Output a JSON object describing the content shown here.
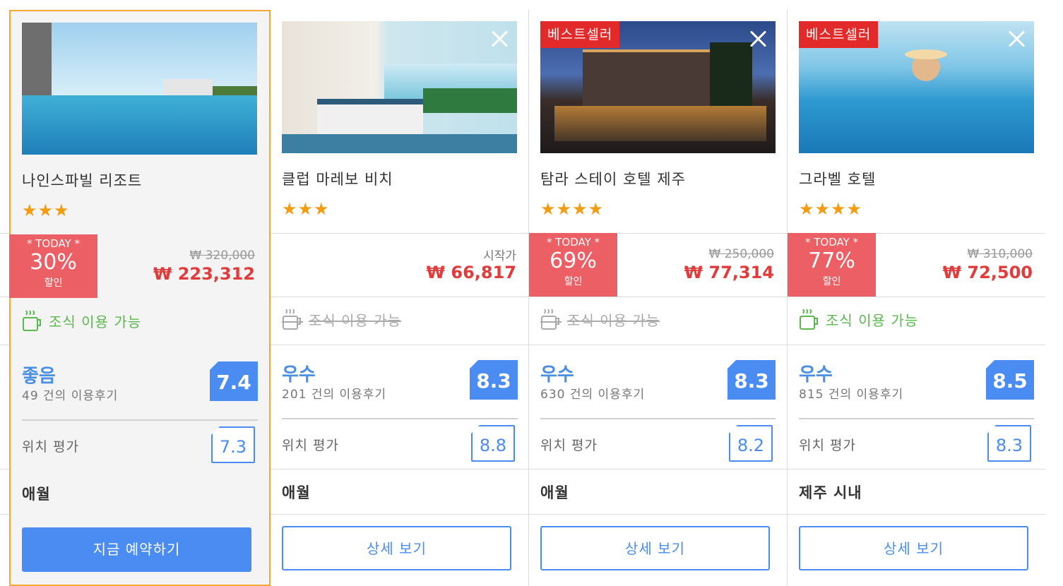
{
  "hotels": [
    {
      "name": "나인스파빌 리조트",
      "stars": "★★★",
      "best_seller": "",
      "deal": {
        "label": "* TODAY *",
        "percent": "30%",
        "unit": "할인"
      },
      "original_price": "₩ 320,000",
      "start_label": "",
      "price": "₩ 223,312",
      "breakfast": "조식 이용 가능",
      "breakfast_available": true,
      "rating_word": "좋음",
      "review_count": "49 건의 이용후기",
      "score": "7.4",
      "location_label": "위치 평가",
      "location_score": "7.3",
      "area": "애월",
      "button": "지금 예약하기"
    },
    {
      "name": "클럽 마레보 비치",
      "stars": "★★★",
      "best_seller": "",
      "deal": null,
      "original_price": "",
      "start_label": "시작가",
      "price": "₩ 66,817",
      "breakfast": "조식 이용 가능",
      "breakfast_available": false,
      "rating_word": "우수",
      "review_count": "201 건의 이용후기",
      "score": "8.3",
      "location_label": "위치 평가",
      "location_score": "8.8",
      "area": "애월",
      "button": "상세 보기"
    },
    {
      "name": "탐라 스테이 호텔 제주",
      "stars": "★★★★",
      "best_seller": "베스트셀러",
      "deal": {
        "label": "* TODAY *",
        "percent": "69%",
        "unit": "할인"
      },
      "original_price": "₩ 250,000",
      "start_label": "",
      "price": "₩ 77,314",
      "breakfast": "조식 이용 가능",
      "breakfast_available": false,
      "rating_word": "우수",
      "review_count": "630 건의 이용후기",
      "score": "8.3",
      "location_label": "위치 평가",
      "location_score": "8.2",
      "area": "애월",
      "button": "상세 보기"
    },
    {
      "name": "그라벨 호텔",
      "stars": "★★★★",
      "best_seller": "베스트셀러",
      "deal": {
        "label": "* TODAY *",
        "percent": "77%",
        "unit": "할인"
      },
      "original_price": "₩ 310,000",
      "start_label": "",
      "price": "₩ 72,500",
      "breakfast": "조식 이용 가능",
      "breakfast_available": true,
      "rating_word": "우수",
      "review_count": "815 건의 이용후기",
      "score": "8.5",
      "location_label": "위치 평가",
      "location_score": "8.3",
      "area": "제주 시내",
      "button": "상세 보기"
    }
  ],
  "colors": {
    "selected_border": "#f5a733",
    "accent_blue": "#4a8cf1",
    "deal_red": "#ec5f65",
    "price_red": "#e03c3c",
    "breakfast_green": "#5ab84e",
    "star_orange": "#f39c12",
    "best_seller_red": "#e22a2a"
  },
  "icons": {
    "close": "close-icon",
    "breakfast": "coffee-cup-icon",
    "star": "star-icon"
  }
}
